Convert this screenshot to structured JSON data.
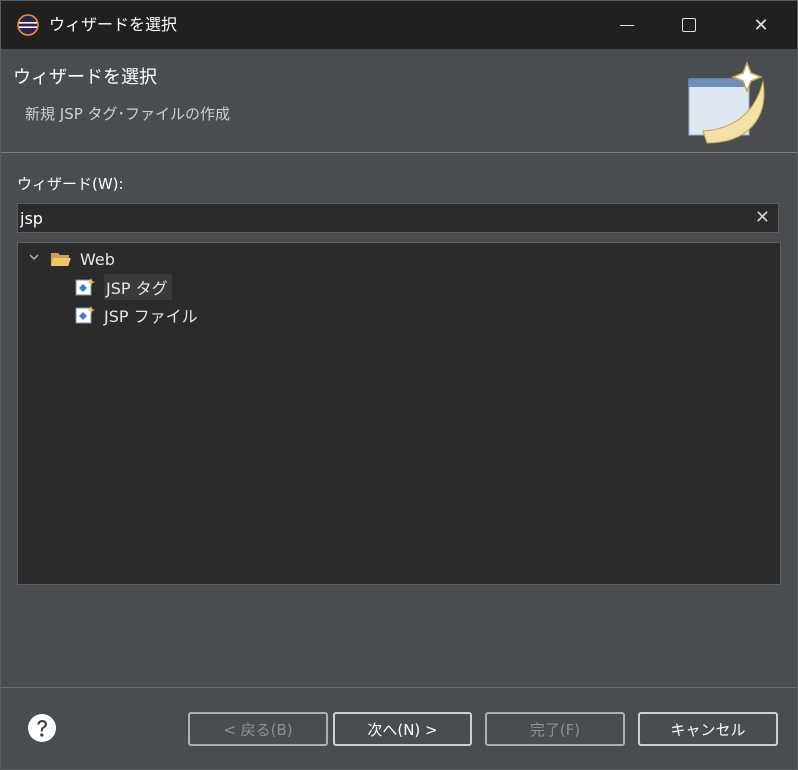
{
  "window": {
    "title": "ウィザードを選択",
    "minimize_label": "",
    "close_glyph": "✕"
  },
  "header": {
    "title": "ウィザードを選択",
    "subtitle": "新規 JSP タグ･ファイルの作成"
  },
  "body": {
    "wizards_label": "ウィザード(W):",
    "filter_value": "jsp",
    "tree": [
      {
        "label": "Web",
        "icon": "folder-open-icon",
        "expanded": true
      },
      {
        "label": "JSP タグ",
        "icon": "jsp-file-icon",
        "selected": true
      },
      {
        "label": "JSP ファイル",
        "icon": "jsp-file-icon"
      }
    ]
  },
  "footer": {
    "back_label": "< 戻る(B)",
    "next_label": "次へ(N) >",
    "finish_label": "完了(F)",
    "cancel_label": "キャンセル"
  },
  "colors": {
    "background": "#4a4d50",
    "titlebar": "#202020",
    "panel": "#2b2b2b"
  }
}
